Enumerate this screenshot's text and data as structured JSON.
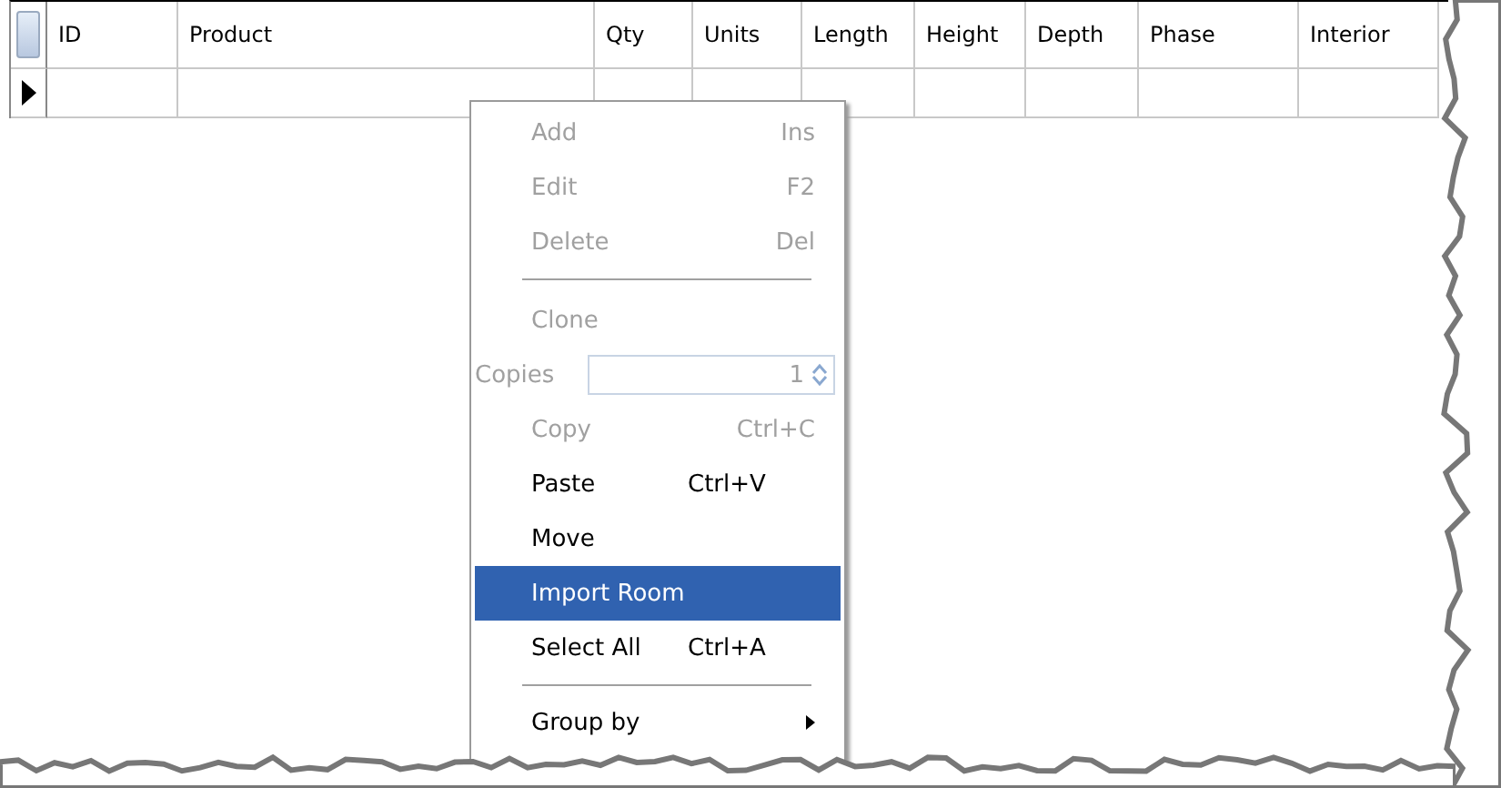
{
  "grid": {
    "columns": [
      {
        "label": "ID"
      },
      {
        "label": "Product"
      },
      {
        "label": "Qty"
      },
      {
        "label": "Units"
      },
      {
        "label": "Length"
      },
      {
        "label": "Height"
      },
      {
        "label": "Depth"
      },
      {
        "label": "Phase"
      },
      {
        "label": "Interior"
      }
    ],
    "rows": [
      {
        "current": true,
        "cells": [
          "",
          "",
          "",
          "",
          "",
          "",
          "",
          "",
          ""
        ]
      }
    ]
  },
  "context_menu": {
    "items": [
      {
        "kind": "item",
        "label": "Add",
        "shortcut": "Ins",
        "disabled": true,
        "selected": false
      },
      {
        "kind": "item",
        "label": "Edit",
        "shortcut": "F2",
        "disabled": true,
        "selected": false
      },
      {
        "kind": "item",
        "label": "Delete",
        "shortcut": "Del",
        "disabled": true,
        "selected": false
      },
      {
        "kind": "separator"
      },
      {
        "kind": "item",
        "label": "Clone",
        "disabled": true,
        "selected": false
      },
      {
        "kind": "spin",
        "label": "Copies",
        "value": "1",
        "disabled": true
      },
      {
        "kind": "item",
        "label": "Copy",
        "shortcut": "Ctrl+C",
        "disabled": true,
        "selected": false
      },
      {
        "kind": "item",
        "label": "Paste",
        "shortcut": "Ctrl+V",
        "disabled": false,
        "selected": false
      },
      {
        "kind": "item",
        "label": "Move",
        "disabled": false,
        "selected": false
      },
      {
        "kind": "item",
        "label": "Import Room",
        "disabled": false,
        "selected": true
      },
      {
        "kind": "item",
        "label": "Select All",
        "shortcut": "Ctrl+A",
        "disabled": false,
        "selected": false
      },
      {
        "kind": "separator"
      },
      {
        "kind": "submenu",
        "label": "Group by",
        "disabled": false,
        "selected": false
      }
    ]
  }
}
